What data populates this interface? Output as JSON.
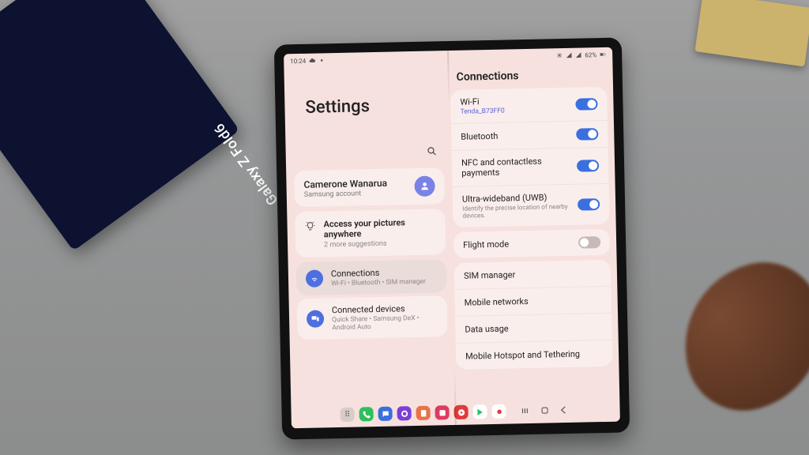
{
  "photo": {
    "box_label": "Galaxy Z Fold6"
  },
  "status": {
    "time": "10:24",
    "battery_text": "62%"
  },
  "left": {
    "title": "Settings",
    "profile": {
      "name": "Camerone Wanarua",
      "subtitle": "Samsung account"
    },
    "suggestion": {
      "title": "Access your pictures anywhere",
      "more": "2 more suggestions"
    },
    "items": [
      {
        "title": "Connections",
        "subtitle": "Wi-Fi • Bluetooth • SIM manager",
        "color": "#4d6fe0",
        "active": true
      },
      {
        "title": "Connected devices",
        "subtitle": "Quick Share • Samsung DeX • Android Auto",
        "color": "#4d6fe0",
        "active": false
      }
    ]
  },
  "right": {
    "title": "Connections",
    "toggles": [
      {
        "label": "Wi-Fi",
        "detail": "Tenda_B73FF0",
        "detail_is_link": true,
        "on": true
      },
      {
        "label": "Bluetooth",
        "detail": "",
        "on": true
      },
      {
        "label": "NFC and contactless payments",
        "detail": "",
        "on": true
      },
      {
        "label": "Ultra-wideband (UWB)",
        "detail": "Identify the precise location of nearby devices.",
        "on": true
      }
    ],
    "flight": {
      "label": "Flight mode",
      "on": false
    },
    "links": [
      {
        "label": "SIM manager"
      },
      {
        "label": "Mobile networks"
      },
      {
        "label": "Data usage"
      },
      {
        "label": "Mobile Hotspot and Tethering"
      }
    ]
  },
  "dock": {
    "apps": [
      {
        "name": "apps",
        "bg": "#d9ccc8",
        "glyph": "⋯"
      },
      {
        "name": "phone",
        "bg": "#2fbf5a",
        "glyph": "✆"
      },
      {
        "name": "messages",
        "bg": "#3a6fe0",
        "glyph": "●"
      },
      {
        "name": "browser",
        "bg": "#7c3ed6",
        "glyph": "◉"
      },
      {
        "name": "notes",
        "bg": "#e05a3a",
        "glyph": "📝"
      },
      {
        "name": "gallery",
        "bg": "#e03a60",
        "glyph": "◧"
      },
      {
        "name": "youtube",
        "bg": "#e03a3a",
        "glyph": "▶"
      },
      {
        "name": "play",
        "bg": "#fff",
        "glyph": "▶"
      },
      {
        "name": "record",
        "bg": "#fff",
        "glyph": "●"
      }
    ]
  }
}
